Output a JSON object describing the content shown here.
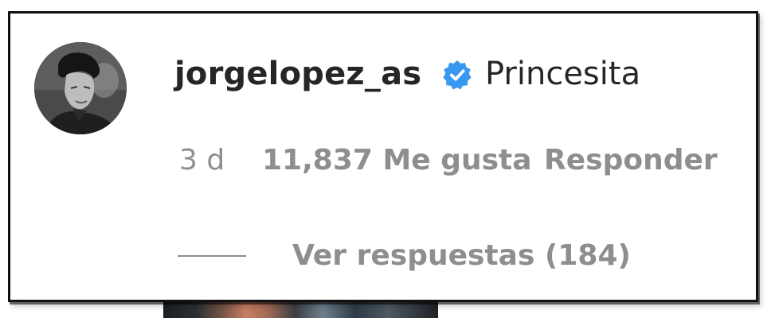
{
  "comment": {
    "username": "jorgelopez_as",
    "verified_icon": "verified-badge-icon",
    "text": "Princesita",
    "time": "3 d",
    "likes": "11,837 Me gusta",
    "reply_label": "Responder",
    "view_replies_label": "Ver respuestas (184)"
  },
  "colors": {
    "text_primary": "#262626",
    "text_secondary": "#8e8e8e",
    "verified_blue": "#3897f0"
  }
}
